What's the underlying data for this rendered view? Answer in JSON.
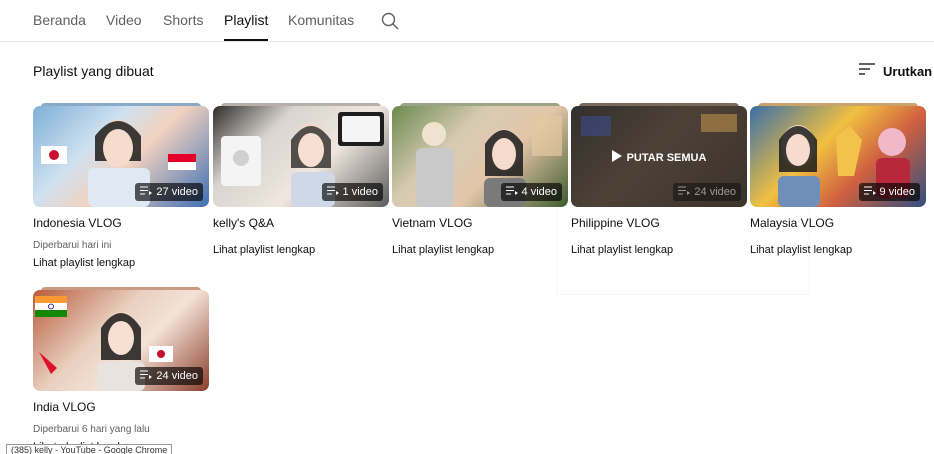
{
  "tabs": [
    {
      "label": "Beranda"
    },
    {
      "label": "Video"
    },
    {
      "label": "Shorts"
    },
    {
      "label": "Playlist"
    },
    {
      "label": "Komunitas"
    }
  ],
  "section": {
    "title": "Playlist yang dibuat",
    "sort_label": "Urutkan"
  },
  "playlists": [
    {
      "title": "Indonesia VLOG",
      "count": "27 video",
      "updated": "Diperbarui hari ini",
      "link": "Lihat playlist lengkap"
    },
    {
      "title": "kelly's Q&A",
      "count": "1 video",
      "link": "Lihat playlist lengkap"
    },
    {
      "title": "Vietnam VLOG",
      "count": "4 video",
      "link": "Lihat playlist lengkap"
    },
    {
      "title": "Philippine VLOG",
      "count": "24 video",
      "link": "Lihat playlist lengkap",
      "overlay": "PUTAR SEMUA"
    },
    {
      "title": "Malaysia VLOG",
      "count": "9 video",
      "link": "Lihat playlist lengkap"
    },
    {
      "title": "India VLOG",
      "count": "24 video",
      "updated": "Diperbarui 6 hari yang lalu",
      "link": "Lihat playlist lengkap"
    }
  ],
  "taskbar_tooltip": "(385) kelly - YouTube - Google Chrome",
  "colors": {
    "text": "#0f0f0f",
    "secondary": "#606060",
    "divider": "#e5e5e5"
  }
}
